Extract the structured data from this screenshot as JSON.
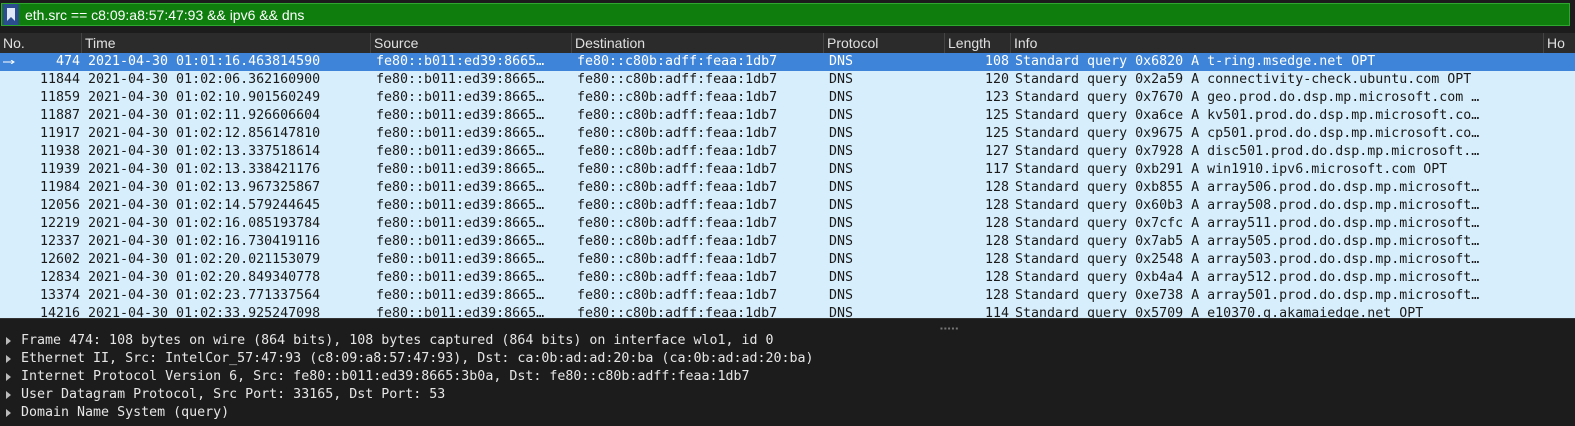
{
  "filter": {
    "expression": "eth.src == c8:09:a8:57:47:93 && ipv6 && dns"
  },
  "columns": {
    "no": "No.",
    "time": "Time",
    "source": "Source",
    "destination": "Destination",
    "protocol": "Protocol",
    "length": "Length",
    "info": "Info",
    "extra": "Ho"
  },
  "packets": [
    {
      "no": "474",
      "time": "2021-04-30 01:01:16.463814590",
      "source": "fe80::b011:ed39:8665…",
      "destination": "fe80::c80b:adff:feaa:1db7",
      "protocol": "DNS",
      "length": "108",
      "info": "Standard query 0x6820 A t-ring.msedge.net OPT"
    },
    {
      "no": "11844",
      "time": "2021-04-30 01:02:06.362160900",
      "source": "fe80::b011:ed39:8665…",
      "destination": "fe80::c80b:adff:feaa:1db7",
      "protocol": "DNS",
      "length": "120",
      "info": "Standard query 0x2a59 A connectivity-check.ubuntu.com OPT"
    },
    {
      "no": "11859",
      "time": "2021-04-30 01:02:10.901560249",
      "source": "fe80::b011:ed39:8665…",
      "destination": "fe80::c80b:adff:feaa:1db7",
      "protocol": "DNS",
      "length": "123",
      "info": "Standard query 0x7670 A geo.prod.do.dsp.mp.microsoft.com …"
    },
    {
      "no": "11887",
      "time": "2021-04-30 01:02:11.926606604",
      "source": "fe80::b011:ed39:8665…",
      "destination": "fe80::c80b:adff:feaa:1db7",
      "protocol": "DNS",
      "length": "125",
      "info": "Standard query 0xa6ce A kv501.prod.do.dsp.mp.microsoft.co…"
    },
    {
      "no": "11917",
      "time": "2021-04-30 01:02:12.856147810",
      "source": "fe80::b011:ed39:8665…",
      "destination": "fe80::c80b:adff:feaa:1db7",
      "protocol": "DNS",
      "length": "125",
      "info": "Standard query 0x9675 A cp501.prod.do.dsp.mp.microsoft.co…"
    },
    {
      "no": "11938",
      "time": "2021-04-30 01:02:13.337518614",
      "source": "fe80::b011:ed39:8665…",
      "destination": "fe80::c80b:adff:feaa:1db7",
      "protocol": "DNS",
      "length": "127",
      "info": "Standard query 0x7928 A disc501.prod.do.dsp.mp.microsoft.…"
    },
    {
      "no": "11939",
      "time": "2021-04-30 01:02:13.338421176",
      "source": "fe80::b011:ed39:8665…",
      "destination": "fe80::c80b:adff:feaa:1db7",
      "protocol": "DNS",
      "length": "117",
      "info": "Standard query 0xb291 A win1910.ipv6.microsoft.com OPT"
    },
    {
      "no": "11984",
      "time": "2021-04-30 01:02:13.967325867",
      "source": "fe80::b011:ed39:8665…",
      "destination": "fe80::c80b:adff:feaa:1db7",
      "protocol": "DNS",
      "length": "128",
      "info": "Standard query 0xb855 A array506.prod.do.dsp.mp.microsoft…"
    },
    {
      "no": "12056",
      "time": "2021-04-30 01:02:14.579244645",
      "source": "fe80::b011:ed39:8665…",
      "destination": "fe80::c80b:adff:feaa:1db7",
      "protocol": "DNS",
      "length": "128",
      "info": "Standard query 0x60b3 A array508.prod.do.dsp.mp.microsoft…"
    },
    {
      "no": "12219",
      "time": "2021-04-30 01:02:16.085193784",
      "source": "fe80::b011:ed39:8665…",
      "destination": "fe80::c80b:adff:feaa:1db7",
      "protocol": "DNS",
      "length": "128",
      "info": "Standard query 0x7cfc A array511.prod.do.dsp.mp.microsoft…"
    },
    {
      "no": "12337",
      "time": "2021-04-30 01:02:16.730419116",
      "source": "fe80::b011:ed39:8665…",
      "destination": "fe80::c80b:adff:feaa:1db7",
      "protocol": "DNS",
      "length": "128",
      "info": "Standard query 0x7ab5 A array505.prod.do.dsp.mp.microsoft…"
    },
    {
      "no": "12602",
      "time": "2021-04-30 01:02:20.021153079",
      "source": "fe80::b011:ed39:8665…",
      "destination": "fe80::c80b:adff:feaa:1db7",
      "protocol": "DNS",
      "length": "128",
      "info": "Standard query 0x2548 A array503.prod.do.dsp.mp.microsoft…"
    },
    {
      "no": "12834",
      "time": "2021-04-30 01:02:20.849340778",
      "source": "fe80::b011:ed39:8665…",
      "destination": "fe80::c80b:adff:feaa:1db7",
      "protocol": "DNS",
      "length": "128",
      "info": "Standard query 0xb4a4 A array512.prod.do.dsp.mp.microsoft…"
    },
    {
      "no": "13374",
      "time": "2021-04-30 01:02:23.771337564",
      "source": "fe80::b011:ed39:8665…",
      "destination": "fe80::c80b:adff:feaa:1db7",
      "protocol": "DNS",
      "length": "128",
      "info": "Standard query 0xe738 A array501.prod.do.dsp.mp.microsoft…"
    },
    {
      "no": "14216",
      "time": "2021-04-30 01:02:33.925247098",
      "source": "fe80::b011:ed39:8665…",
      "destination": "fe80::c80b:adff:feaa:1db7",
      "protocol": "DNS",
      "length": "114",
      "info": "Standard query 0x5709 A e10370.g.akamaiedge.net OPT"
    }
  ],
  "details": [
    "Frame 474: 108 bytes on wire (864 bits), 108 bytes captured (864 bits) on interface wlo1, id 0",
    "Ethernet II, Src: IntelCor_57:47:93 (c8:09:a8:57:47:93), Dst: ca:0b:ad:ad:20:ba (ca:0b:ad:ad:20:ba)",
    "Internet Protocol Version 6, Src: fe80::b011:ed39:8665:3b0a, Dst: fe80::c80b:adff:feaa:1db7",
    "User Datagram Protocol, Src Port: 33165, Dst Port: 53",
    "Domain Name System (query)"
  ],
  "colors": {
    "filter_valid": "#0e7d0e",
    "row_bg": "#d7eefc",
    "row_selected": "#3e84d9",
    "pane_bg": "#1c1c1c"
  }
}
